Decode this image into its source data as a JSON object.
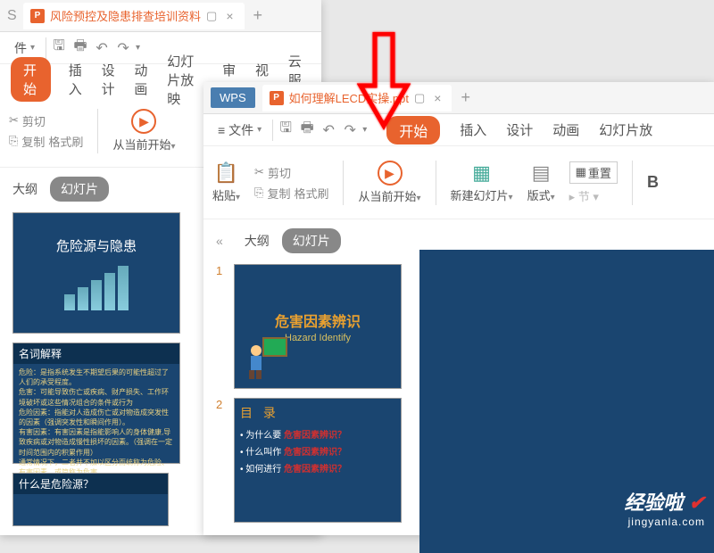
{
  "win1": {
    "tab_title": "风险预控及隐患排查培训资料",
    "file_label": "件",
    "menu": {
      "start": "开始",
      "insert": "插入",
      "design": "设计",
      "animation": "动画",
      "slideshow": "幻灯片放映",
      "review": "审阅",
      "view": "视图",
      "cloud": "云服务"
    },
    "ribbon": {
      "cut": "剪切",
      "copy": "复制",
      "format": "格式刷",
      "from_current": "从当前开始"
    },
    "panel": {
      "outline": "大纲",
      "slides": "幻灯片"
    },
    "slide1": {
      "title": "危险源与隐患"
    },
    "slide2": {
      "header": "名词解释",
      "lines": [
        "危险：是指系统发生不期望后果的可能性超过了人们的承受程度。",
        "危害：可能导致伤亡或疾病、财产损失、工作环境破坏或这些情况组合的条件或行为",
        "危险因素：指能对人造成伤亡或对物造成突发性的因素（强调突发性和瞬间作用）。",
        "有害因素：有害因素是指能影响人的身体健康,导致疾病或对物造成慢性损坏的因素。（强调在一定时间范围内的积累作用）",
        "通常情况下，二者并不加以区分而统称为危险、有害因素，或简称为危害。"
      ]
    },
    "slide3": {
      "header": "什么是危险源？"
    }
  },
  "win2": {
    "wps": "WPS",
    "tab_title": "如何理解LECD实操.ppt",
    "file_label": "文件",
    "menu": {
      "start": "开始",
      "insert": "插入",
      "design": "设计",
      "animation": "动画",
      "slideshow": "幻灯片放"
    },
    "ribbon": {
      "paste": "粘贴",
      "cut": "剪切",
      "copy": "复制",
      "format": "格式刷",
      "from_current": "从当前开始",
      "new_slide": "新建幻灯片",
      "layout": "版式",
      "reset": "重置",
      "bold": "B"
    },
    "panel": {
      "outline": "大纲",
      "slides": "幻灯片"
    },
    "slide1": {
      "zh": "危害因素辨识",
      "en": "Hazard  Identify"
    },
    "slide2": {
      "mulv": "目 录",
      "items": [
        {
          "a": "为什么要",
          "b": "危害因素辨识？"
        },
        {
          "a": "什么叫作",
          "b": "危害因素辨识？"
        },
        {
          "a": "如何进行",
          "b": "危害因素辨识？"
        }
      ]
    }
  },
  "watermark": {
    "text": "经验啦",
    "url": "jingyanla.com"
  }
}
